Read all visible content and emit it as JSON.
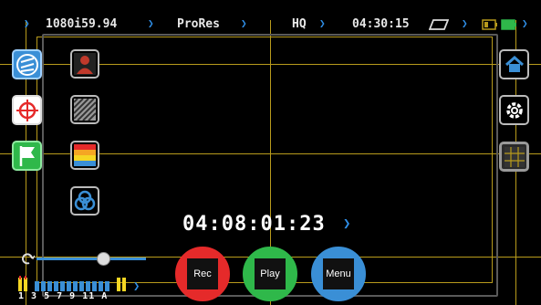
{
  "status": {
    "format": "1080i59.94",
    "codec": "ProRes",
    "quality": "HQ",
    "remaining": "04:30:15"
  },
  "timecode": "04:08:01:23",
  "buttons": {
    "rec": "Rec",
    "play": "Play",
    "menu": "Menu"
  },
  "audio": {
    "channel_labels": "1 3 5 7 9 11 A"
  },
  "colors": {
    "rec": "#e52a2a",
    "play": "#2fb84a",
    "menu": "#3a8fd6",
    "accent": "#2f8fe8",
    "guide": "#b89b1c"
  },
  "icons": [
    "zebra-icon",
    "crosshair-icon",
    "flag-icon",
    "false-color-icon",
    "peaking-icon",
    "color-bars-icon",
    "rgb-circles-icon",
    "home-icon",
    "gear-icon",
    "grid-icon",
    "tape-icon",
    "battery-icon",
    "loop-icon"
  ]
}
